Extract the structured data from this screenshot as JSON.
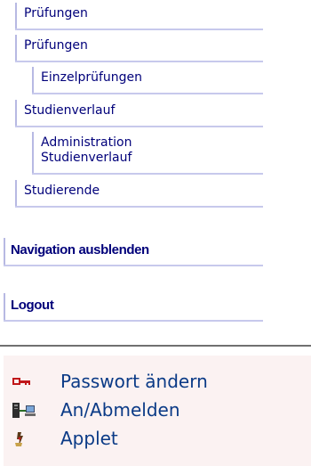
{
  "nav": {
    "items": [
      {
        "label": "Prüfungen"
      },
      {
        "label": "Prüfungen"
      },
      {
        "label": "Einzelprüfungen"
      },
      {
        "label": "Studienverlauf"
      },
      {
        "label_line1": "Administration",
        "label_line2": "Studienverlauf"
      },
      {
        "label": "Studierende"
      }
    ],
    "hide_navigation": "Navigation ausblenden",
    "logout": "Logout"
  },
  "footer": {
    "links": [
      {
        "label": "Passwort ändern",
        "icon": "key-icon"
      },
      {
        "label": "An/Abmelden",
        "icon": "server-computer-icon"
      },
      {
        "label": "Applet",
        "icon": "applet-icon"
      }
    ]
  },
  "colors": {
    "link_text": "#00007a",
    "nav_border": "#b7b9e3",
    "footer_background": "#fbf2f2",
    "footer_link_text": "#0a3a86",
    "divider": "#707070"
  }
}
